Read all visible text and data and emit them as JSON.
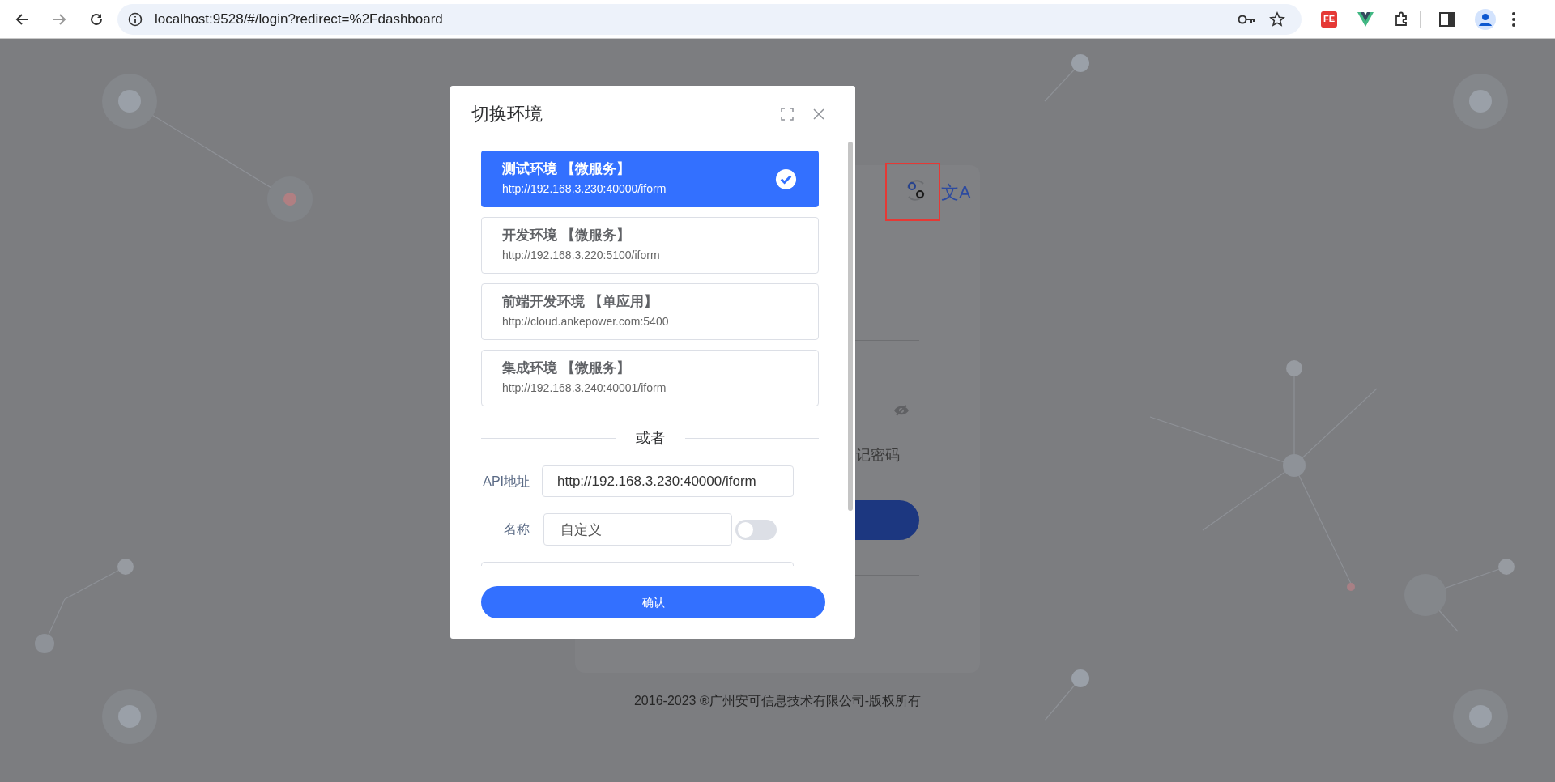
{
  "browser": {
    "url": "localhost:9528/#/login?redirect=%2Fdashboard",
    "extension_badge": "FE"
  },
  "login_card": {
    "translate_icon": "文A",
    "remember_label": "记密码"
  },
  "footer": "2016-2023 ®广州安可信息技术有限公司-版权所有",
  "dialog": {
    "title": "切换环境",
    "environments": [
      {
        "name": "测试环境 【微服务】",
        "url": "http://192.168.3.230:40000/iform",
        "selected": true
      },
      {
        "name": "开发环境 【微服务】",
        "url": "http://192.168.3.220:5100/iform",
        "selected": false
      },
      {
        "name": "前端开发环境 【单应用】",
        "url": "http://cloud.ankepower.com:5400",
        "selected": false
      },
      {
        "name": "集成环境 【微服务】",
        "url": "http://192.168.3.240:40001/iform",
        "selected": false
      }
    ],
    "divider": "或者",
    "api_label": "API地址",
    "api_value": "http://192.168.3.230:40000/iform",
    "name_label": "名称",
    "name_value": "自定义",
    "custom_name_on": false,
    "confirm": "确认"
  }
}
